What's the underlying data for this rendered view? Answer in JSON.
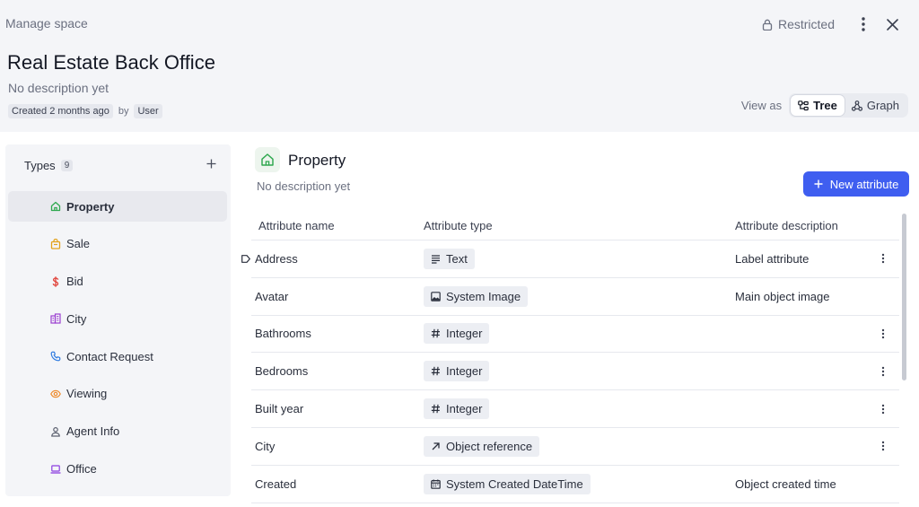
{
  "header": {
    "manage_label": "Manage space",
    "restricted_label": "Restricted",
    "title": "Real Estate Back Office",
    "description": "No description yet",
    "created_label": "Created 2 months ago",
    "by_label": "by",
    "user_label": "User",
    "view_as_label": "View as",
    "views": [
      {
        "label": "Tree",
        "active": true
      },
      {
        "label": "Graph",
        "active": false
      }
    ]
  },
  "sidebar": {
    "types_label": "Types",
    "types_count": "9",
    "items": [
      {
        "label": "Property",
        "icon": "home-icon",
        "color": "#2fa84f",
        "active": true
      },
      {
        "label": "Sale",
        "icon": "bag-icon",
        "color": "#e3a21a"
      },
      {
        "label": "Bid",
        "icon": "dollar-icon",
        "color": "#e0423a"
      },
      {
        "label": "City",
        "icon": "building-icon",
        "color": "#9b3fd0"
      },
      {
        "label": "Contact Request",
        "icon": "phone-icon",
        "color": "#2f7be0"
      },
      {
        "label": "Viewing",
        "icon": "eye-icon",
        "color": "#ee8a2a"
      },
      {
        "label": "Agent Info",
        "icon": "user-icon",
        "color": "#5a5f6e"
      },
      {
        "label": "Office",
        "icon": "laptop-icon",
        "color": "#8b3fe0"
      }
    ]
  },
  "main": {
    "title": "Property",
    "description": "No description yet",
    "new_attribute_label": "New attribute",
    "columns": {
      "name": "Attribute name",
      "type": "Attribute type",
      "description": "Attribute description"
    },
    "rows": [
      {
        "name": "Address",
        "type": "Text",
        "type_icon": "text-icon",
        "description": "Label attribute",
        "label": true,
        "menu": true
      },
      {
        "name": "Avatar",
        "type": "System Image",
        "type_icon": "image-icon",
        "description": "Main object image",
        "label": false,
        "menu": false
      },
      {
        "name": "Bathrooms",
        "type": "Integer",
        "type_icon": "hash-icon",
        "description": "",
        "label": false,
        "menu": true
      },
      {
        "name": "Bedrooms",
        "type": "Integer",
        "type_icon": "hash-icon",
        "description": "",
        "label": false,
        "menu": true
      },
      {
        "name": "Built year",
        "type": "Integer",
        "type_icon": "hash-icon",
        "description": "",
        "label": false,
        "menu": true
      },
      {
        "name": "City",
        "type": "Object reference",
        "type_icon": "arrow-up-right-icon",
        "description": "",
        "label": false,
        "menu": true
      },
      {
        "name": "Created",
        "type": "System Created DateTime",
        "type_icon": "calendar-icon",
        "description": "Object created time",
        "label": false,
        "menu": false
      }
    ]
  },
  "colors": {
    "accent": "#3f5ef0",
    "header_bg": "#f4f5f8"
  }
}
